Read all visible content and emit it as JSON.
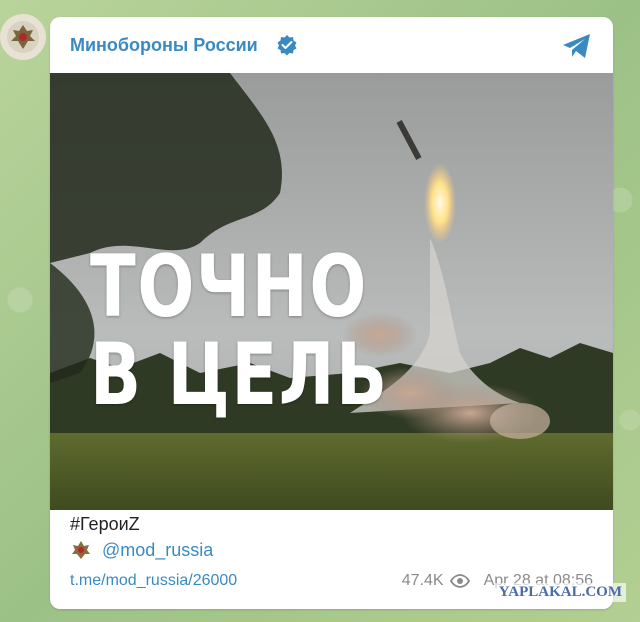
{
  "channel": {
    "name": "Минобороны России",
    "verified_icon": "verified-badge-icon",
    "share_icon": "telegram-share-icon",
    "avatar_icon": "ministry-emblem-icon",
    "accent_color": "#3a8ac2"
  },
  "post": {
    "headline_line1": "ТОЧНО",
    "headline_line2": "В ЦЕЛЬ",
    "hashtag": "#ГероиZ",
    "author_handle": "@mod_russia",
    "author_icon": "emblem-icon",
    "link": "t.me/mod_russia/26000",
    "views": "47.4K",
    "views_icon": "eye-icon",
    "date": "Apr 28 at 08:56"
  },
  "watermark": {
    "text": "YAPLAKAL.COM"
  }
}
